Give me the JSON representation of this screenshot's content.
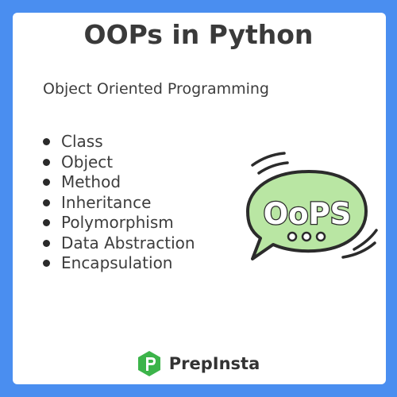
{
  "header": {
    "title": "OOPs in Python",
    "subtitle": "Object Oriented Programming"
  },
  "topics": [
    "Class",
    "Object",
    "Method",
    "Inheritance",
    "Polymorphism",
    "Data Abstraction",
    "Encapsulation"
  ],
  "illustration": {
    "text": "OoPS",
    "icon": "speech-bubble-icon",
    "bubble_color": "#b9e6a3",
    "outline_color": "#2b2b2b"
  },
  "footer": {
    "brand": "PrepInsta",
    "logo_icon": "prepinsta-logo-icon",
    "logo_color": "#3cb44a"
  },
  "colors": {
    "background": "#4a8ef0",
    "card": "#ffffff",
    "text": "#3a3a3a"
  }
}
